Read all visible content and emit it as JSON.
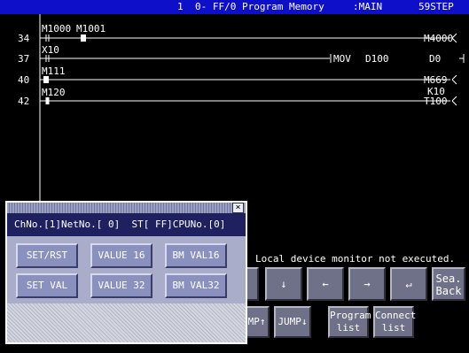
{
  "titlebar": {
    "channel": "1",
    "program_name": "0- FF/0 Program Memory",
    "program": ":MAIN",
    "steps": "59STEP"
  },
  "ladder": {
    "step_numbers": [
      "34",
      "37",
      "40",
      "42"
    ],
    "contacts": {
      "r34_a": "M1000",
      "r34_b": "M1001",
      "r37": "X10",
      "r40": "M111",
      "r42": "M120"
    },
    "coils": {
      "r34": "M4000",
      "r37_inst": "MOV",
      "r37_s": "D100",
      "r37_d": "D0",
      "r40": "M669",
      "r42_k": "K10",
      "r42": "T100"
    }
  },
  "status_message": "Local device monitor not executed.",
  "keys": {
    "row1": [
      "↓",
      "←",
      "→",
      "↵",
      "Sea.",
      "Back"
    ],
    "row2": [
      "JUMP↑",
      "JUMP↓",
      "Program",
      "list",
      "Connect",
      "list"
    ]
  },
  "popup": {
    "close": "×",
    "info": "ChNo.[1]NetNo.[ 0]  ST[ FF]CPUNo.[0]",
    "buttons": [
      "SET/RST",
      "VALUE 16",
      "BM VAL16",
      "SET VAL",
      "VALUE 32",
      "BM VAL32"
    ]
  },
  "colors": {
    "titlebar": "#0d10c8",
    "background": "#000000",
    "popup_panel": "#a9adc9",
    "popup_button": "#8b91bf",
    "key_button": "#6e7187"
  }
}
